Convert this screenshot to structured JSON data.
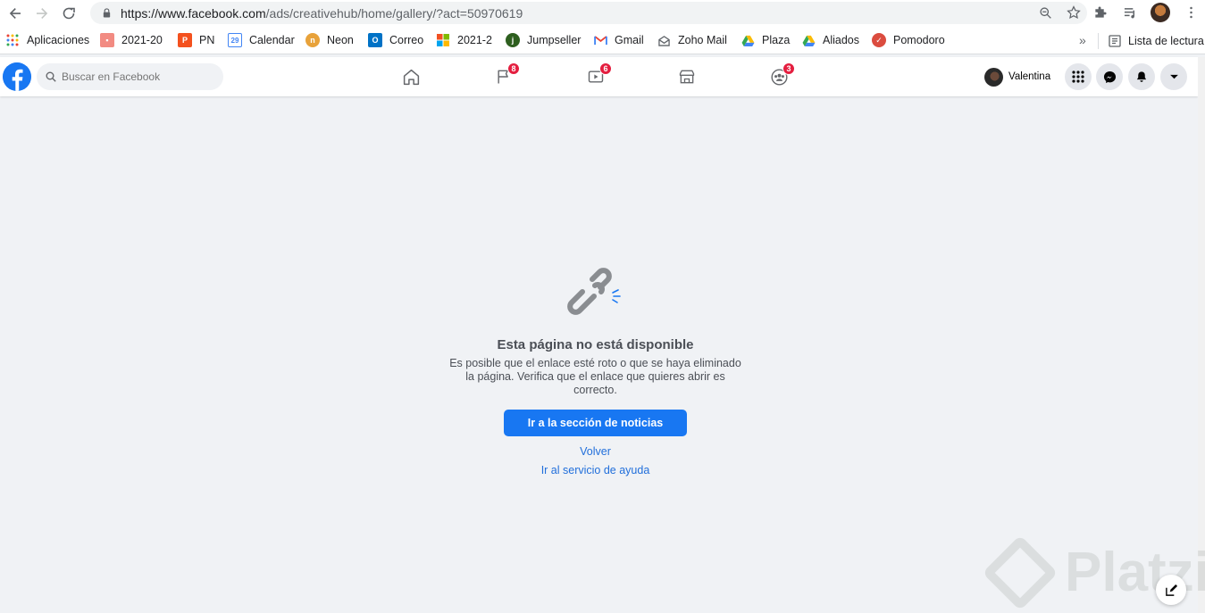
{
  "browser": {
    "url_host": "https://www.facebook.com",
    "url_path": "/ads/creativehub/home/gallery/?act=50970619"
  },
  "bookmarks": {
    "items": [
      {
        "label": "Aplicaciones",
        "icon": "apps-grid-icon",
        "color": "#ea4335"
      },
      {
        "label": "2021-20",
        "icon": "notebook-icon",
        "color": "#f28b82"
      },
      {
        "label": "PN",
        "icon": "pn-icon",
        "color": "#f4511e"
      },
      {
        "label": "Calendar",
        "icon": "calendar-icon",
        "color": "#4285f4"
      },
      {
        "label": "Neon",
        "icon": "neon-icon",
        "color": "#e8a23a"
      },
      {
        "label": "Correo",
        "icon": "outlook-icon",
        "color": "#0072c6"
      },
      {
        "label": "2021-2",
        "icon": "microsoft-icon",
        "color": "#f25022"
      },
      {
        "label": "Jumpseller",
        "icon": "jumpseller-icon",
        "color": "#2e5f1f"
      },
      {
        "label": "Gmail",
        "icon": "gmail-icon",
        "color": "#ea4335"
      },
      {
        "label": "Zoho Mail",
        "icon": "zoho-mail-icon",
        "color": "#5f6368"
      },
      {
        "label": "Plaza",
        "icon": "drive-icon",
        "color": "#34a853"
      },
      {
        "label": "Aliados",
        "icon": "drive-icon",
        "color": "#fbbc04"
      },
      {
        "label": "Pomodoro",
        "icon": "pomodoro-icon",
        "color": "#db4c3f"
      }
    ],
    "more": "»",
    "reading_list": "Lista de lectura"
  },
  "facebook": {
    "search_placeholder": "Buscar en Facebook",
    "badges": {
      "pages": "8",
      "watch": "6",
      "groups": "3"
    },
    "user_name": "Valentina",
    "brand_color": "#1877f2"
  },
  "error": {
    "title": "Esta página no está disponible",
    "description": "Es posible que el enlace esté roto o que se haya eliminado la página. Verifica que el enlace que quieres abrir es correcto.",
    "primary_button": "Ir a la sección de noticias",
    "back_link": "Volver",
    "help_link": "Ir al servicio de ayuda"
  },
  "watermark": {
    "text": "Platzi"
  }
}
